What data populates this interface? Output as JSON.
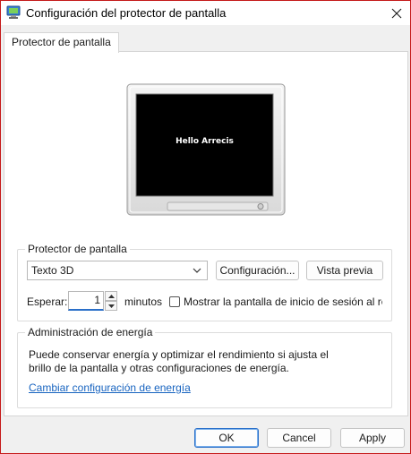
{
  "window": {
    "title": "Configuración del protector de pantalla"
  },
  "tabs": [
    {
      "label": "Protector de pantalla"
    }
  ],
  "preview": {
    "screen_text": "Hello Arrecis"
  },
  "screensaver_group": {
    "title": "Protector de pantalla",
    "selected_screensaver": "Texto 3D",
    "settings_button": "Configuración...",
    "preview_button": "Vista previa",
    "wait_label": "Esperar:",
    "wait_value": "1",
    "minutes_label": "minutos",
    "logon_checkbox_label": "Mostrar la pantalla de inicio de sesión al re",
    "logon_checked": false
  },
  "power_group": {
    "title": "Administración de energía",
    "description_line1": "Puede conservar energía y optimizar el rendimiento si ajusta el",
    "description_line2": "brillo de la pantalla y otras configuraciones de energía.",
    "link": "Cambiar configuración de energía"
  },
  "footer": {
    "ok": "OK",
    "cancel": "Cancel",
    "apply": "Apply"
  },
  "colors": {
    "accent": "#2a6fc9",
    "link": "#1864c0",
    "window_border": "#c51a1a"
  },
  "icons": {
    "app": "screensaver-app-icon",
    "close": "close-icon",
    "dropdown": "chevron-down-icon",
    "spin_up": "caret-up-icon",
    "spin_down": "caret-down-icon"
  }
}
